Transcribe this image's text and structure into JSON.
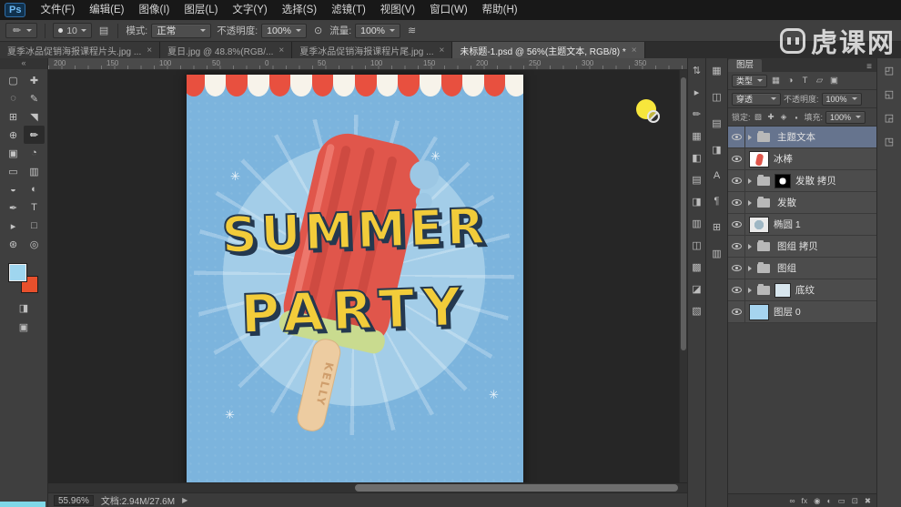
{
  "colors": {
    "foreground_swatch": "#9fd6ef",
    "background_swatch": "#e8502c",
    "selected_layer_row": "#66748e",
    "brush_cursor": "#f7e63c",
    "poster_background": "#7cb4dd",
    "popsicle_red": "#e0564b",
    "title_yellow": "#f2cc3a",
    "awning_red": "#e8503f"
  },
  "menubar": {
    "logo": "Ps",
    "items": [
      "文件(F)",
      "编辑(E)",
      "图像(I)",
      "图层(L)",
      "文字(Y)",
      "选择(S)",
      "滤镜(T)",
      "视图(V)",
      "窗口(W)",
      "帮助(H)"
    ]
  },
  "options": {
    "tool_icon": "✏",
    "brush_size": "10",
    "panel_toggle_icon": "▤",
    "mode_label": "模式:",
    "mode_value": "正常",
    "opacity_label": "不透明度:",
    "opacity_value": "100%",
    "pressure_icon": "⊙",
    "flow_label": "流量:",
    "flow_value": "100%",
    "airbrush_icon": "≋"
  },
  "watermark": "虎课网",
  "tabs": [
    {
      "title": "夏季冰品促销海报课程片头.jpg ...",
      "close": "×"
    },
    {
      "title": "夏日.jpg @ 48.8%(RGB/...",
      "close": "×"
    },
    {
      "title": "夏季冰品促销海报课程片尾.jpg ...",
      "close": "×"
    },
    {
      "title": "未标题-1.psd @ 56%(主题文本, RGB/8) *",
      "close": "×"
    }
  ],
  "toolbar": {
    "collapse": "«",
    "tools": [
      {
        "name": "rectangular-marquee-tool",
        "glyph": "▢"
      },
      {
        "name": "move-tool",
        "glyph": "✚"
      },
      {
        "name": "lasso-tool",
        "glyph": "◌"
      },
      {
        "name": "quick-selection-tool",
        "glyph": "✎"
      },
      {
        "name": "crop-tool",
        "glyph": "⊞"
      },
      {
        "name": "eyedropper-tool",
        "glyph": "◥"
      },
      {
        "name": "spot-healing-brush-tool",
        "glyph": "⊕"
      },
      {
        "name": "brush-tool",
        "glyph": "✏"
      },
      {
        "name": "clone-stamp-tool",
        "glyph": "▣"
      },
      {
        "name": "history-brush-tool",
        "glyph": "◔"
      },
      {
        "name": "eraser-tool",
        "glyph": "▭"
      },
      {
        "name": "gradient-tool",
        "glyph": "▥"
      },
      {
        "name": "blur-tool",
        "glyph": "◒"
      },
      {
        "name": "dodge-tool",
        "glyph": "◐"
      },
      {
        "name": "pen-tool",
        "glyph": "✒"
      },
      {
        "name": "type-tool",
        "glyph": "T"
      },
      {
        "name": "path-selection-tool",
        "glyph": "▸"
      },
      {
        "name": "rectangle-tool",
        "glyph": "□"
      },
      {
        "name": "hand-tool",
        "glyph": "⊛"
      },
      {
        "name": "zoom-tool",
        "glyph": "◎"
      }
    ],
    "quick_mask_icon": "◨",
    "screen_mode_icon": "▣"
  },
  "ruler": {
    "numbers": [
      "200",
      "150",
      "100",
      "50",
      "0",
      "50",
      "100",
      "150",
      "200",
      "250",
      "300",
      "350"
    ]
  },
  "poster": {
    "line1": "SUMMER",
    "line2": "PARTY",
    "stick_text": "KELLY",
    "sparkle": "✳"
  },
  "panels": {
    "strip_a": [
      "⇅",
      "▸",
      "✏",
      "▦",
      "◧",
      "▤",
      "◨",
      "▥",
      "◫",
      "▩",
      "◪",
      "▧"
    ],
    "strip_b": [
      "▦",
      "◫",
      "▤",
      "◨",
      "A",
      "¶",
      "⊞",
      "▥"
    ],
    "strip_right": [
      "◰",
      "◱",
      "◲",
      "◳"
    ]
  },
  "layers_panel": {
    "panel_tab": "图层",
    "menu_icon": "≡",
    "filter_label": "类型",
    "filter_icons": [
      "▦",
      "◑",
      "T",
      "▱",
      "▣"
    ],
    "blend_mode": "穿透",
    "opacity_label": "不透明度:",
    "opacity_value": "100%",
    "lock_label": "锁定:",
    "lock_icons": [
      "▨",
      "✚",
      "◈",
      "▪"
    ],
    "fill_label": "填充:",
    "fill_value": "100%",
    "rows": [
      {
        "name": "主题文本"
      },
      {
        "name": "冰棒"
      },
      {
        "name": "发散 拷贝"
      },
      {
        "name": "发散"
      },
      {
        "name": "椭圆 1"
      },
      {
        "name": "图组 拷贝"
      },
      {
        "name": "图组"
      },
      {
        "name": "底纹"
      },
      {
        "name": "图层 0"
      }
    ],
    "bottom_icons": [
      "∞",
      "fx",
      "◉",
      "◐",
      "▭",
      "⊡",
      "✖"
    ]
  },
  "status": {
    "zoom": "55.96%",
    "doc": "文档:2.94M/27.6M",
    "arrow": "▶"
  }
}
